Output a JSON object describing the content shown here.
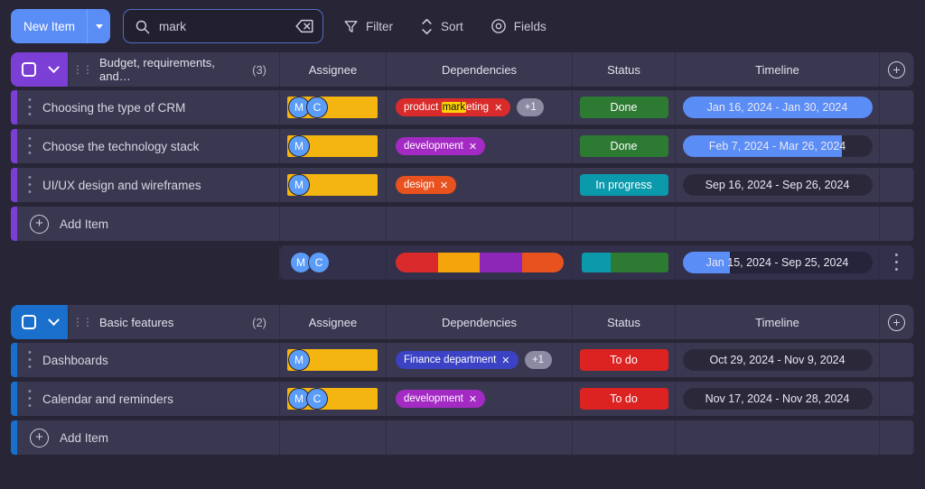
{
  "toolbar": {
    "new_item_label": "New Item",
    "new_item_caret": "chevron-down",
    "search": {
      "value": "mark",
      "placeholder": "Search",
      "clear_icon": "backspace-icon"
    },
    "filter_label": "Filter",
    "sort_label": "Sort",
    "fields_label": "Fields"
  },
  "columns": {
    "assignee": "Assignee",
    "dependencies": "Dependencies",
    "status": "Status",
    "timeline": "Timeline"
  },
  "add_item_label": "Add Item",
  "colors": {
    "accent_purple": "#7c3fd6",
    "accent_blue": "#1b6fcc",
    "assignee_bar": "#f5b511",
    "avatar": "#5b9cf8",
    "timeline_fill": "#5b8df6",
    "highlight": "#ffd400"
  },
  "groups": [
    {
      "name": "Budget, requirements, and…",
      "count": "(3)",
      "accent": "#7c3fd6",
      "rows": [
        {
          "name": "Choosing the type of CRM",
          "avatars": [
            "M",
            "C"
          ],
          "tags": [
            {
              "text_before": "product ",
              "highlight": "mark",
              "text_after": "eting",
              "color": "#d92b2b"
            }
          ],
          "more": "+1",
          "status": {
            "label": "Done",
            "color": "#2d7a32"
          },
          "timeline": {
            "label": "Jan 16, 2024 - Jan 30, 2024",
            "fill_pct": 100
          }
        },
        {
          "name": "Choose the technology stack",
          "avatars": [
            "M"
          ],
          "tags": [
            {
              "text_before": "development",
              "highlight": "",
              "text_after": "",
              "color": "#a32bc4"
            }
          ],
          "more": "",
          "status": {
            "label": "Done",
            "color": "#2d7a32"
          },
          "timeline": {
            "label": "Feb 7, 2024 - Mar 26, 2024",
            "fill_pct": 84
          }
        },
        {
          "name": "UI/UX design and wireframes",
          "avatars": [
            "M"
          ],
          "tags": [
            {
              "text_before": "design",
              "highlight": "",
              "text_after": "",
              "color": "#e8521f"
            }
          ],
          "more": "",
          "status": {
            "label": "In progress",
            "color": "#0b9aab"
          },
          "timeline": {
            "label": "Sep 16, 2024 - Sep 26, 2024",
            "fill_pct": 0
          }
        }
      ],
      "summary": {
        "avatars": [
          "M",
          "C"
        ],
        "dep_segments": [
          {
            "color": "#d92b2b",
            "pct": 25
          },
          {
            "color": "#f5a50b",
            "pct": 25
          },
          {
            "color": "#8c27b8",
            "pct": 25
          },
          {
            "color": "#e8521f",
            "pct": 25
          }
        ],
        "status_segments": [
          {
            "color": "#0b9aab",
            "pct": 33
          },
          {
            "color": "#2d7a32",
            "pct": 67
          }
        ],
        "timeline": {
          "label": "Jan 15, 2024 - Sep 25, 2024",
          "fill_pct": 25
        },
        "menu_icon": "kebab-icon"
      }
    },
    {
      "name": "Basic features",
      "count": "(2)",
      "accent": "#1b6fcc",
      "rows": [
        {
          "name": "Dashboards",
          "avatars": [
            "M"
          ],
          "tags": [
            {
              "text_before": "Finance department",
              "highlight": "",
              "text_after": "",
              "color": "#3b42c4"
            }
          ],
          "more": "+1",
          "status": {
            "label": "To do",
            "color": "#dd2222"
          },
          "timeline": {
            "label": "Oct 29, 2024 - Nov 9, 2024",
            "fill_pct": 0
          }
        },
        {
          "name": "Calendar and reminders",
          "avatars": [
            "M",
            "C"
          ],
          "tags": [
            {
              "text_before": "development",
              "highlight": "",
              "text_after": "",
              "color": "#a32bc4"
            }
          ],
          "more": "",
          "status": {
            "label": "To do",
            "color": "#dd2222"
          },
          "timeline": {
            "label": "Nov 17, 2024 - Nov 28, 2024",
            "fill_pct": 0
          }
        }
      ]
    }
  ]
}
